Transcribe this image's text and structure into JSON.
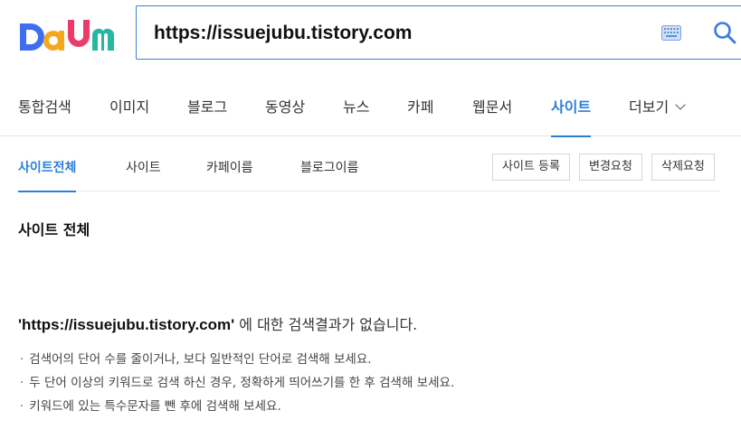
{
  "header": {
    "logo_text": "Daum",
    "search_value": "https://issuejubu.tistory.com",
    "keyboard_icon": "keyboard-icon",
    "search_icon": "search-icon"
  },
  "tabs": [
    {
      "label": "통합검색",
      "active": false
    },
    {
      "label": "이미지",
      "active": false
    },
    {
      "label": "블로그",
      "active": false
    },
    {
      "label": "동영상",
      "active": false
    },
    {
      "label": "뉴스",
      "active": false
    },
    {
      "label": "카페",
      "active": false
    },
    {
      "label": "웹문서",
      "active": false
    },
    {
      "label": "사이트",
      "active": true
    },
    {
      "label": "더보기",
      "active": false
    }
  ],
  "subtabs": [
    {
      "label": "사이트전체",
      "active": true
    },
    {
      "label": "사이트",
      "active": false
    },
    {
      "label": "카페이름",
      "active": false
    },
    {
      "label": "블로그이름",
      "active": false
    }
  ],
  "buttons": {
    "register": "사이트 등록",
    "change": "변경요청",
    "delete": "삭제요청"
  },
  "section_title": "사이트 전체",
  "no_result": {
    "query": "'https://issuejubu.tistory.com'",
    "message": " 에 대한 검색결과가 없습니다."
  },
  "tips": [
    "검색어의 단어 수를 줄이거나, 보다 일반적인 단어로 검색해 보세요.",
    "두 단어 이상의 키워드로 검색 하신 경우, 정확하게 띄어쓰기를 한 후 검색해 보세요.",
    "키워드에 있는 특수문자를 뺀 후에 검색해 보세요."
  ],
  "colors": {
    "accent": "#2b7fd9",
    "search_border": "#3d7dd4"
  }
}
